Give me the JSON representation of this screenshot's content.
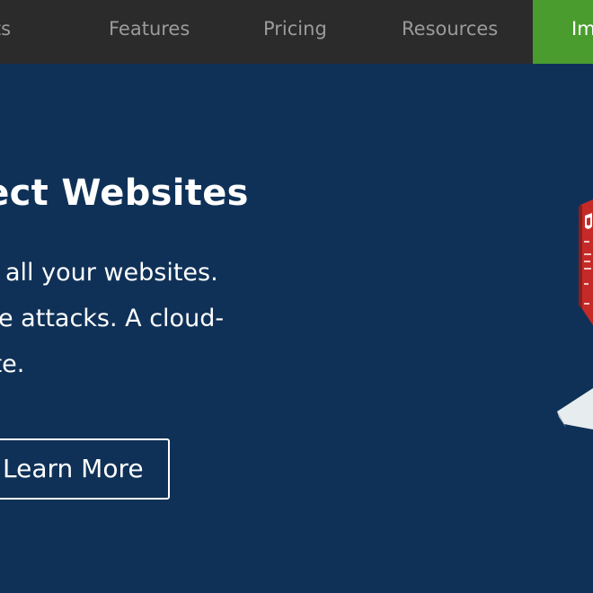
{
  "nav": {
    "items": [
      {
        "label": "ucts"
      },
      {
        "label": "Features"
      },
      {
        "label": "Pricing"
      },
      {
        "label": "Resources"
      }
    ],
    "cta_label": "Im"
  },
  "hero": {
    "title": "rotect Websites",
    "lines": [
      "ecuring all your websites.",
      "t future attacks. A cloud-",
      " site."
    ],
    "button_label": "Learn More"
  },
  "colors": {
    "nav_bg": "#2b2b2b",
    "hero_bg": "#0f3157",
    "cta_green": "#4b9c2f",
    "illustration_red": "#c62a28"
  },
  "icons": [
    "security-shield-icon"
  ]
}
